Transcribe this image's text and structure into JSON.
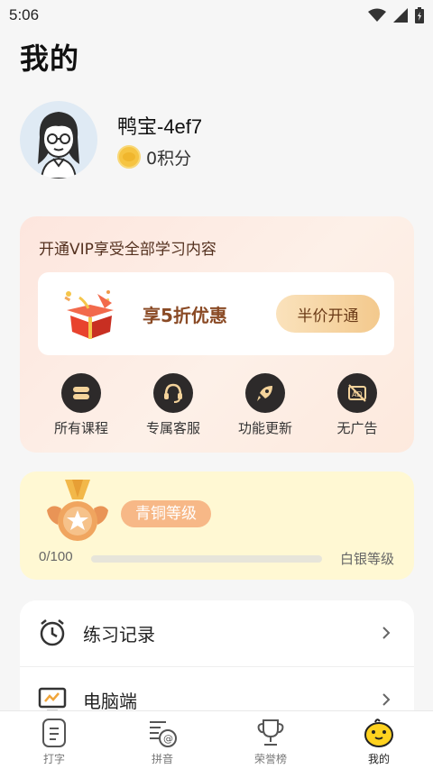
{
  "status": {
    "time": "5:06"
  },
  "page": {
    "title": "我的"
  },
  "profile": {
    "username": "鸭宝-4ef7",
    "points": "0积分"
  },
  "vip": {
    "title": "开通VIP享受全部学习内容",
    "discount_text": "享5折优惠",
    "button_label": "半价开通",
    "benefits": [
      {
        "label": "所有课程",
        "icon": "course-icon"
      },
      {
        "label": "专属客服",
        "icon": "headset-icon"
      },
      {
        "label": "功能更新",
        "icon": "rocket-icon"
      },
      {
        "label": "无广告",
        "icon": "no-ad-icon"
      }
    ]
  },
  "level": {
    "current": "青铜等级",
    "progress_text": "0/100",
    "progress_fraction": 0,
    "next": "白银等级"
  },
  "menu": {
    "items": [
      {
        "label": "练习记录",
        "icon": "clock-icon"
      },
      {
        "label": "电脑端",
        "icon": "monitor-icon"
      }
    ]
  },
  "tabs": [
    {
      "label": "打字",
      "icon": "typing-icon"
    },
    {
      "label": "拼音",
      "icon": "pinyin-icon"
    },
    {
      "label": "荣誉榜",
      "icon": "trophy-icon"
    },
    {
      "label": "我的",
      "icon": "duck-icon",
      "active": true
    }
  ],
  "colors": {
    "accent": "#f3c98d",
    "vip_bg": "#fde6de",
    "level_bg": "#fff8d3",
    "badge": "#f7b887"
  }
}
